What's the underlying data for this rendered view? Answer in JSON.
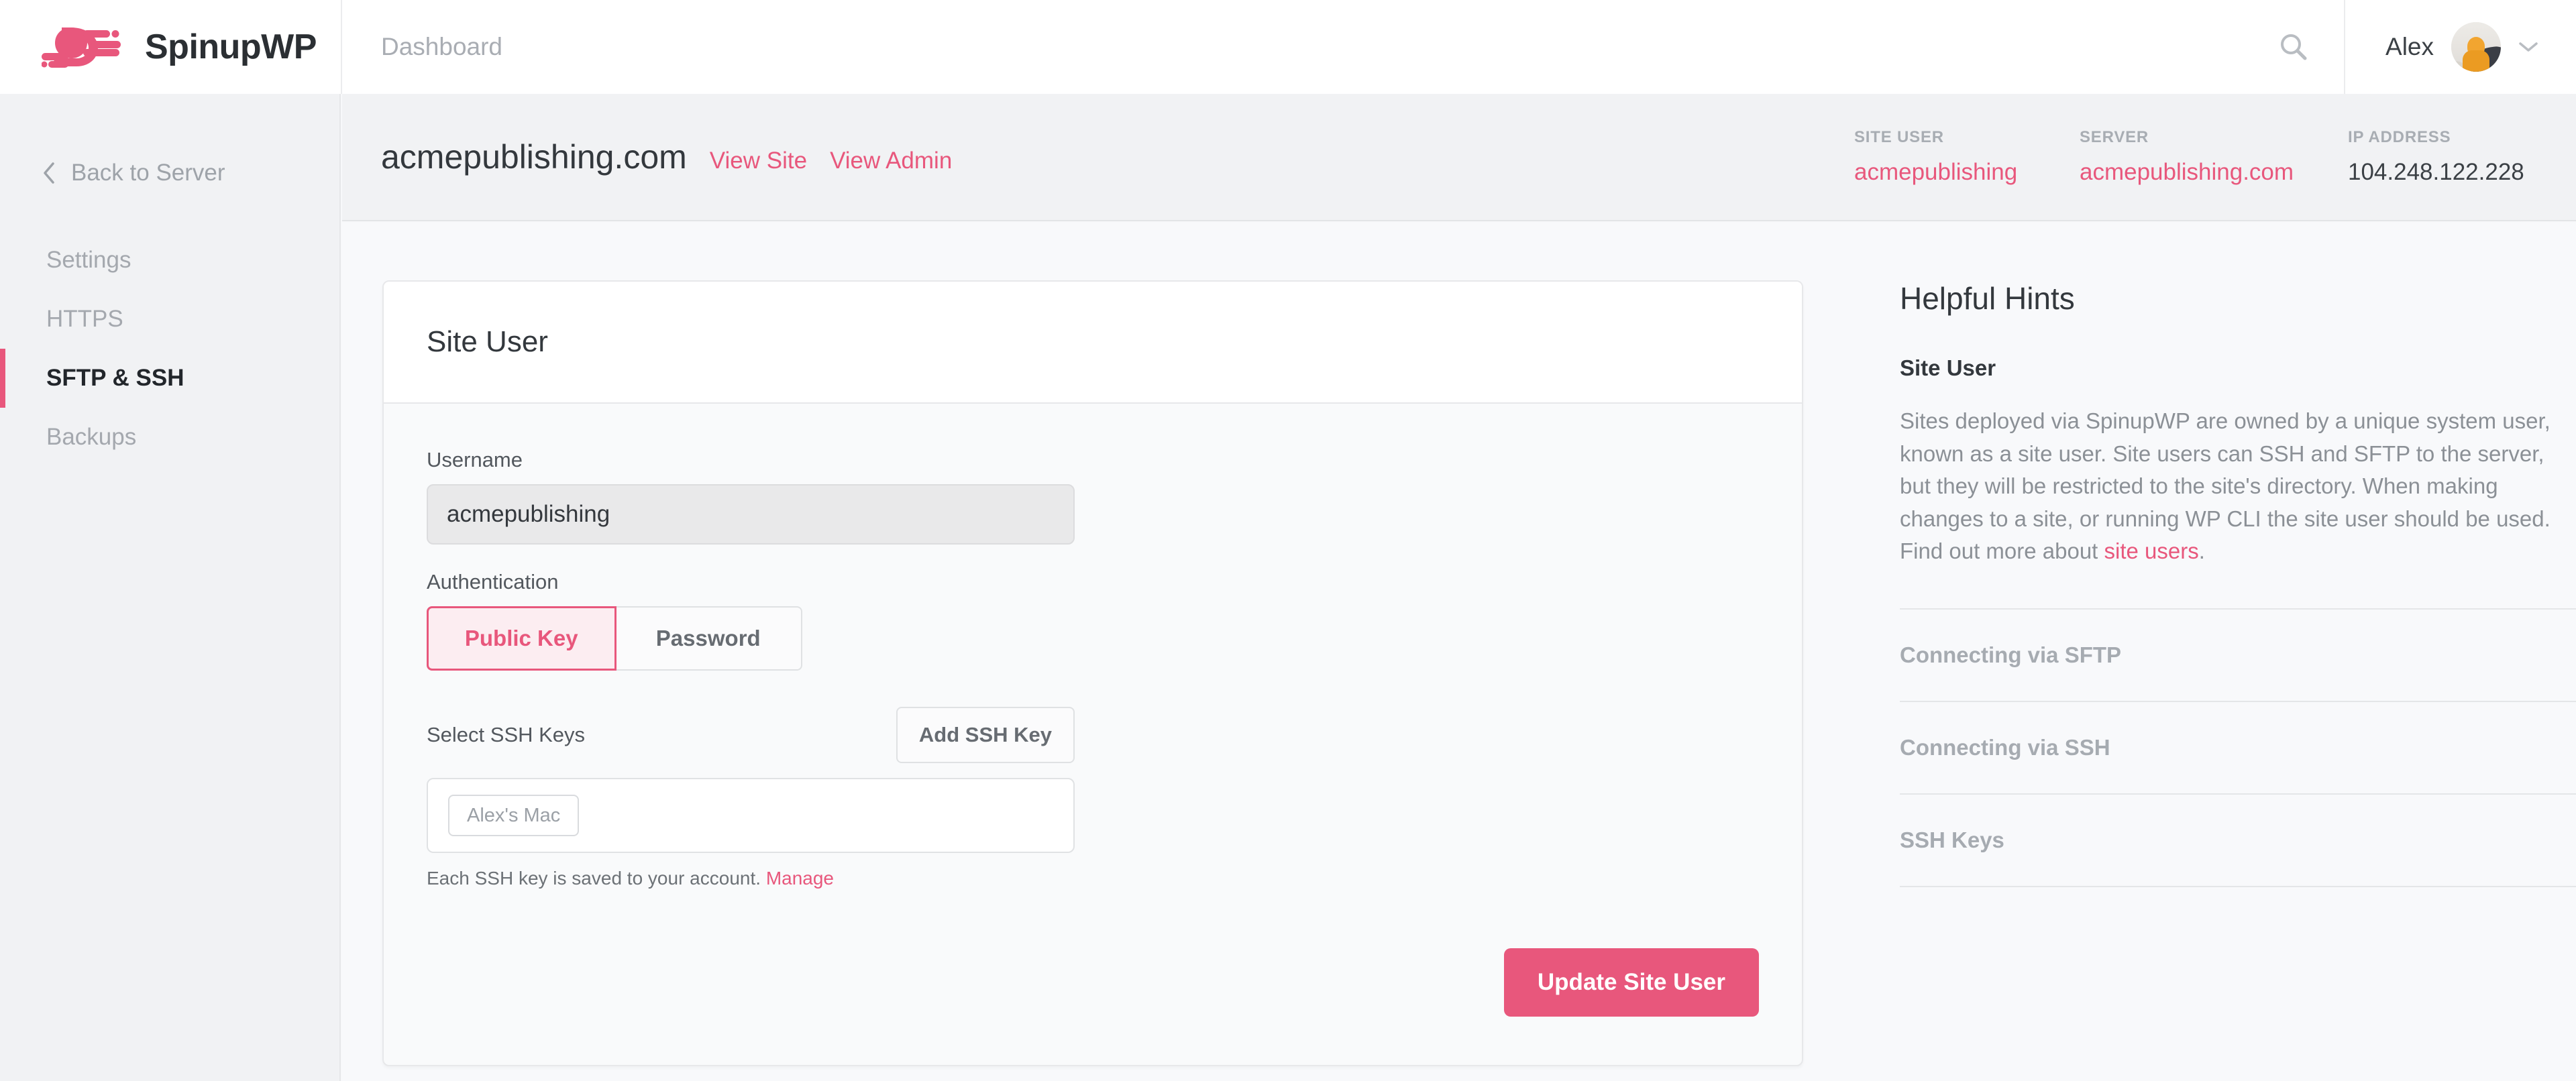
{
  "topbar": {
    "logo_text": "SpinupWP",
    "nav": [
      {
        "label": "Dashboard"
      }
    ],
    "search_icon": "search-icon",
    "user_name": "Alex",
    "chevron_icon": "chevron-down-icon"
  },
  "sidebar": {
    "back_label": "Back to Server",
    "back_icon": "chevron-left-icon",
    "items": [
      {
        "label": "Settings",
        "active": false
      },
      {
        "label": "HTTPS",
        "active": false
      },
      {
        "label": "SFTP & SSH",
        "active": true
      },
      {
        "label": "Backups",
        "active": false
      }
    ]
  },
  "site_header": {
    "title": "acmepublishing.com",
    "links": [
      {
        "label": "View Site"
      },
      {
        "label": "View Admin"
      }
    ],
    "meta": [
      {
        "label": "SITE USER",
        "value": "acmepublishing",
        "link": true
      },
      {
        "label": "SERVER",
        "value": "acmepublishing.com",
        "link": true
      },
      {
        "label": "IP ADDRESS",
        "value": "104.248.122.228",
        "link": false
      }
    ]
  },
  "card": {
    "title": "Site User",
    "username_label": "Username",
    "username_value": "acmepublishing",
    "auth_label": "Authentication",
    "auth_options": [
      {
        "label": "Public Key",
        "selected": true
      },
      {
        "label": "Password",
        "selected": false
      }
    ],
    "keys_label": "Select SSH Keys",
    "add_key_button": "Add SSH Key",
    "keys": [
      {
        "label": "Alex's Mac"
      }
    ],
    "help_text": "Each SSH key is saved to your account.",
    "help_link": "Manage",
    "submit_button": "Update Site User"
  },
  "hints": {
    "title": "Helpful Hints",
    "section_heading": "Site User",
    "section_body": "Sites deployed via SpinupWP are owned by a unique system user, known as a site user. Site users can SSH and SFTP to the server, but they will be restricted to the site's directory. When making changes to a site, or running WP CLI the site user should be used. Find out more about ",
    "section_link": "site users",
    "section_body_end": ".",
    "accordion": [
      {
        "label": "Connecting via SFTP"
      },
      {
        "label": "Connecting via SSH"
      },
      {
        "label": "SSH Keys"
      }
    ]
  },
  "colors": {
    "accent": "#e8577c",
    "accent_soft": "#fcedf1",
    "text_dark": "#33383d",
    "text_muted": "#a4a8ae",
    "page_bg": "#f8f9fb",
    "sidebar_bg": "#f1f2f4"
  }
}
